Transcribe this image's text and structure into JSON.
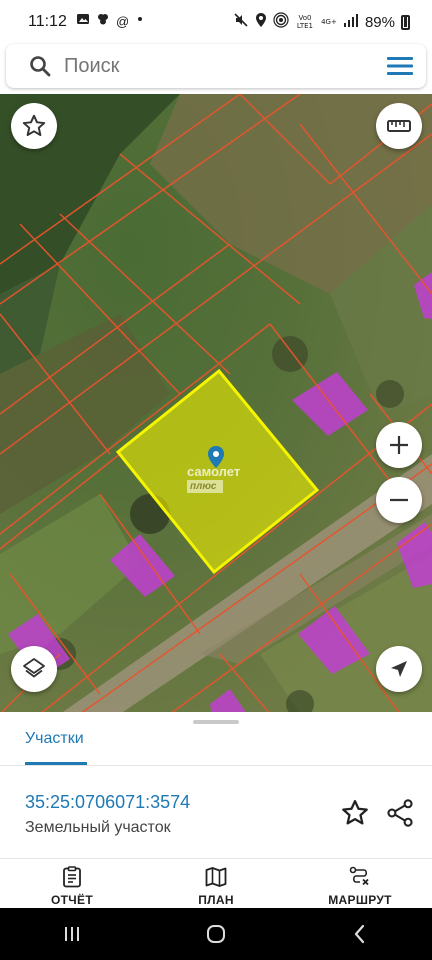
{
  "status_bar": {
    "time": "11:12",
    "left_icons": [
      "gallery-icon",
      "windmill-icon",
      "at-icon",
      "dot-icon"
    ],
    "right_icons": [
      "mute-icon",
      "location-icon",
      "hotspot-icon",
      "volte-icon",
      "signal-icon",
      "battery-icon"
    ],
    "volte_label": "Vo0 LTE1",
    "net_label": "4G+",
    "battery": "89%"
  },
  "search": {
    "placeholder": "Поиск"
  },
  "map": {
    "watermark_main": "самолет",
    "watermark_sub": "плюс",
    "parcel_highlight_color": "#f0f000",
    "boundary_color": "#e8542d",
    "building_color": "#c040d0"
  },
  "sheet": {
    "tab_label": "Участки",
    "parcel_number": "35:25:0706071:3574",
    "parcel_type": "Земельный участок"
  },
  "actions": [
    {
      "label": "ОТЧЁТ",
      "icon": "report-icon"
    },
    {
      "label": "ПЛАН",
      "icon": "map-plan-icon"
    },
    {
      "label": "МАРШРУТ",
      "icon": "route-icon"
    }
  ],
  "colors": {
    "accent": "#1e79b5"
  }
}
